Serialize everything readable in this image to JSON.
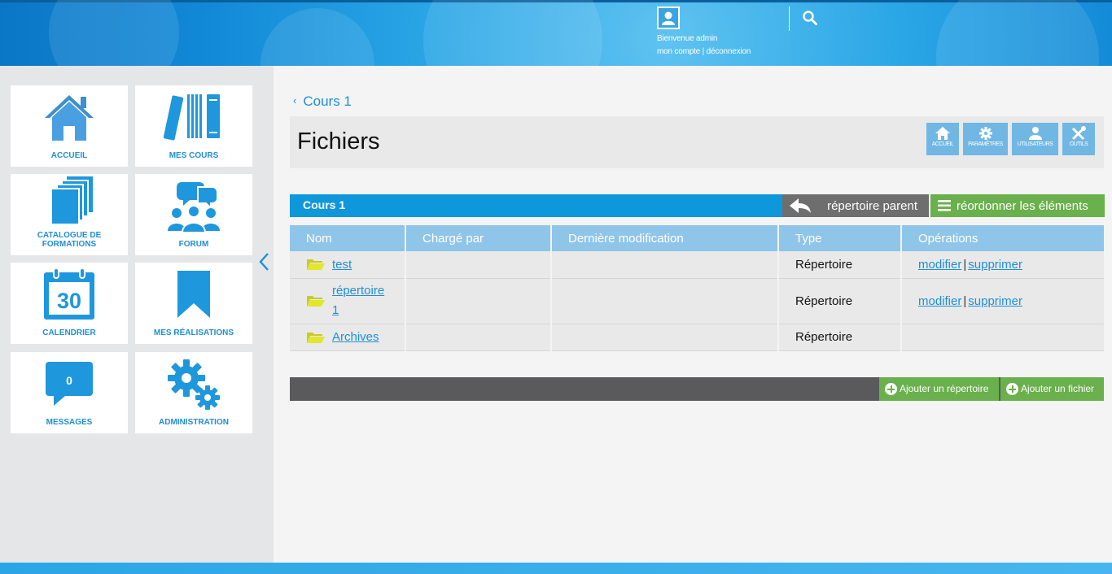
{
  "header": {
    "welcome": "Bienvenue admin",
    "account_link": "mon compte",
    "separator": "|",
    "logout_link": "déconnexion"
  },
  "sidebar": {
    "tiles": [
      {
        "label": "ACCUEIL",
        "icon": "home-icon"
      },
      {
        "label": "MES COURS",
        "icon": "books-icon"
      },
      {
        "label": "CATALOGUE DE FORMATIONS",
        "icon": "catalog-icon"
      },
      {
        "label": "FORUM",
        "icon": "forum-icon"
      },
      {
        "label": "CALENDRIER",
        "icon": "calendar-icon",
        "day": "30"
      },
      {
        "label": "MES RÉALISATIONS",
        "icon": "bookmark-icon"
      },
      {
        "label": "MESSAGES",
        "icon": "message-icon",
        "count": "0"
      },
      {
        "label": "ADMINISTRATION",
        "icon": "gears-icon"
      }
    ],
    "accent_color": "#1f8fd5"
  },
  "main": {
    "back_label": "Cours 1",
    "title": "Fichiers",
    "tools": [
      {
        "label": "ACCUEIL",
        "icon": "home-icon"
      },
      {
        "label": "PARAMÈTRES",
        "icon": "gear-icon"
      },
      {
        "label": "UTILISATEURS",
        "icon": "user-icon"
      },
      {
        "label": "OUTILS",
        "icon": "tools-icon"
      }
    ],
    "folder_name": "Cours 1",
    "parent_label": "répertoire parent",
    "reorder_label": "réordonner les éléments",
    "table": {
      "columns": [
        "Nom",
        "Chargé par",
        "Dernière modification",
        "Type",
        "Opérations"
      ],
      "rows": [
        {
          "name": "test",
          "uploaded_by": "",
          "modified": "",
          "type": "Répertoire",
          "edit": "modifier",
          "delete": "supprimer"
        },
        {
          "name": "répertoire 1",
          "uploaded_by": "",
          "modified": "",
          "type": "Répertoire",
          "edit": "modifier",
          "delete": "supprimer"
        },
        {
          "name": "Archives",
          "uploaded_by": "",
          "modified": "",
          "type": "Répertoire",
          "edit": "",
          "delete": ""
        }
      ],
      "op_separator": "|"
    },
    "add_folder_label": "Ajouter un répertoire",
    "add_file_label": "Ajouter un fichier"
  }
}
